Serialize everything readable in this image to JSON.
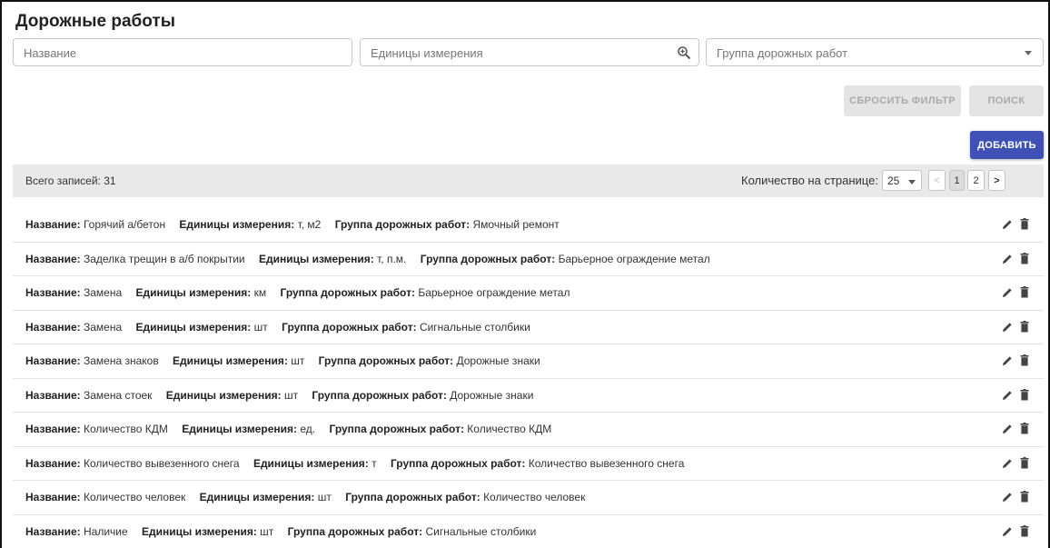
{
  "page": {
    "title": "Дорожные работы"
  },
  "filters": {
    "name_placeholder": "Название",
    "units_placeholder": "Единицы измерения",
    "group_placeholder": "Группа дорожных работ"
  },
  "actions": {
    "reset_label": "СБРОСИТЬ ФИЛЬТР",
    "search_label": "ПОИСК",
    "add_label": "ДОБАВИТЬ"
  },
  "list_header": {
    "total_text": "Всего записей: 31",
    "per_page_label": "Количество на странице:",
    "per_page_value": "25",
    "pagination": {
      "prev": "<",
      "pages": [
        "1",
        "2"
      ],
      "next": ">",
      "current": "1"
    }
  },
  "field_labels": {
    "name": "Название:",
    "units": "Единицы измерения:",
    "group": "Группа дорожных работ:"
  },
  "rows": [
    {
      "name": "Горячий а/бетон",
      "units": "т, м2",
      "group": "Ямочный ремонт"
    },
    {
      "name": "Заделка трещин в а/б покрытии",
      "units": "т, п.м.",
      "group": "Барьерное ограждение метал"
    },
    {
      "name": "Замена",
      "units": "км",
      "group": "Барьерное ограждение метал"
    },
    {
      "name": "Замена",
      "units": "шт",
      "group": "Сигнальные столбики"
    },
    {
      "name": "Замена знаков",
      "units": "шт",
      "group": "Дорожные знаки"
    },
    {
      "name": "Замена стоек",
      "units": "шт",
      "group": "Дорожные знаки"
    },
    {
      "name": "Количество КДМ",
      "units": "ед.",
      "group": "Количество КДМ"
    },
    {
      "name": "Количество вывезенного снега",
      "units": "т",
      "group": "Количество вывезенного снега"
    },
    {
      "name": "Количество человек",
      "units": "шт",
      "group": "Количество человек"
    },
    {
      "name": "Наличие",
      "units": "шт",
      "group": "Сигнальные столбики"
    }
  ],
  "icons": {
    "units_field": "zoom-in-icon",
    "group_field": "chevron-down-icon",
    "row_edit": "pencil-icon",
    "row_delete": "trash-icon"
  },
  "colors": {
    "primary": "#3f51b5",
    "disabled_bg": "#e4e4e4",
    "header_bar_bg": "#e9e9e9"
  }
}
